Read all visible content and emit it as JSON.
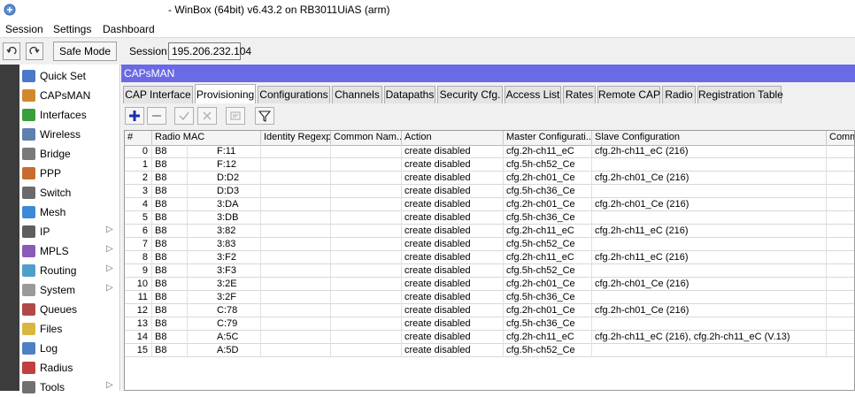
{
  "window": {
    "title": " - WinBox (64bit) v6.43.2 on RB3011UiAS (arm)"
  },
  "menu": [
    "Session",
    "Settings",
    "Dashboard"
  ],
  "toolbar": {
    "undo_icon": "undo-icon",
    "redo_icon": "redo-icon",
    "safe_mode": "Safe Mode",
    "session_label": "Session:",
    "session_value": "195.206.232.104"
  },
  "sidebar": {
    "items": [
      {
        "label": "Quick Set",
        "icon": "quick-set-icon",
        "arrow": false
      },
      {
        "label": "CAPsMAN",
        "icon": "capsman-icon",
        "arrow": false
      },
      {
        "label": "Interfaces",
        "icon": "interfaces-icon",
        "arrow": false
      },
      {
        "label": "Wireless",
        "icon": "wireless-icon",
        "arrow": false
      },
      {
        "label": "Bridge",
        "icon": "bridge-icon",
        "arrow": false
      },
      {
        "label": "PPP",
        "icon": "ppp-icon",
        "arrow": false
      },
      {
        "label": "Switch",
        "icon": "switch-icon",
        "arrow": false
      },
      {
        "label": "Mesh",
        "icon": "mesh-icon",
        "arrow": false
      },
      {
        "label": "IP",
        "icon": "ip-icon",
        "arrow": true
      },
      {
        "label": "MPLS",
        "icon": "mpls-icon",
        "arrow": true
      },
      {
        "label": "Routing",
        "icon": "routing-icon",
        "arrow": true
      },
      {
        "label": "System",
        "icon": "system-icon",
        "arrow": true
      },
      {
        "label": "Queues",
        "icon": "queues-icon",
        "arrow": false
      },
      {
        "label": "Files",
        "icon": "files-icon",
        "arrow": false
      },
      {
        "label": "Log",
        "icon": "log-icon",
        "arrow": false
      },
      {
        "label": "Radius",
        "icon": "radius-icon",
        "arrow": false
      },
      {
        "label": "Tools",
        "icon": "tools-icon",
        "arrow": true
      }
    ]
  },
  "capsman": {
    "title": "CAPsMAN",
    "tabs": [
      {
        "label": "CAP Interface",
        "active": false
      },
      {
        "label": "Provisioning",
        "active": true
      },
      {
        "label": "Configurations",
        "active": false
      },
      {
        "label": "Channels",
        "active": false
      },
      {
        "label": "Datapaths",
        "active": false
      },
      {
        "label": "Security Cfg.",
        "active": false
      },
      {
        "label": "Access List",
        "active": false
      },
      {
        "label": "Rates",
        "active": false
      },
      {
        "label": "Remote CAP",
        "active": false
      },
      {
        "label": "Radio",
        "active": false
      },
      {
        "label": "Registration Table",
        "active": false
      }
    ],
    "actions": [
      "add-icon",
      "remove-icon",
      "enable-icon",
      "disable-icon",
      "comment-icon",
      "filter-icon"
    ],
    "columns": [
      "#",
      "Radio MAC",
      "Identity Regexp",
      "Common Nam...",
      "Action",
      "Master Configurati...",
      "Slave Configuration",
      "Comme"
    ],
    "rows": [
      [
        "0",
        "B8",
        "F:11",
        "",
        "",
        "create disabled",
        "cfg.2h-ch11_eC",
        "cfg.2h-ch11_eC (216)",
        ""
      ],
      [
        "1",
        "B8",
        "F:12",
        "",
        "",
        "create disabled",
        "cfg.5h-ch52_Ce",
        "",
        ""
      ],
      [
        "2",
        "B8",
        "D:D2",
        "",
        "",
        "create disabled",
        "cfg.2h-ch01_Ce",
        "cfg.2h-ch01_Ce (216)",
        ""
      ],
      [
        "3",
        "B8",
        "D:D3",
        "",
        "",
        "create disabled",
        "cfg.5h-ch36_Ce",
        "",
        ""
      ],
      [
        "4",
        "B8",
        "3:DA",
        "",
        "",
        "create disabled",
        "cfg.2h-ch01_Ce",
        "cfg.2h-ch01_Ce (216)",
        ""
      ],
      [
        "5",
        "B8",
        "3:DB",
        "",
        "",
        "create disabled",
        "cfg.5h-ch36_Ce",
        "",
        ""
      ],
      [
        "6",
        "B8",
        "3:82",
        "",
        "",
        "create disabled",
        "cfg.2h-ch11_eC",
        "cfg.2h-ch11_eC (216)",
        ""
      ],
      [
        "7",
        "B8",
        "3:83",
        "",
        "",
        "create disabled",
        "cfg.5h-ch52_Ce",
        "",
        ""
      ],
      [
        "8",
        "B8",
        "3:F2",
        "",
        "",
        "create disabled",
        "cfg.2h-ch11_eC",
        "cfg.2h-ch11_eC (216)",
        ""
      ],
      [
        "9",
        "B8",
        "3:F3",
        "",
        "",
        "create disabled",
        "cfg.5h-ch52_Ce",
        "",
        ""
      ],
      [
        "10",
        "B8",
        "3:2E",
        "",
        "",
        "create disabled",
        "cfg.2h-ch01_Ce",
        "cfg.2h-ch01_Ce (216)",
        ""
      ],
      [
        "11",
        "B8",
        "3:2F",
        "",
        "",
        "create disabled",
        "cfg.5h-ch36_Ce",
        "",
        ""
      ],
      [
        "12",
        "B8",
        "C:78",
        "",
        "",
        "create disabled",
        "cfg.2h-ch01_Ce",
        "cfg.2h-ch01_Ce (216)",
        ""
      ],
      [
        "13",
        "B8",
        "C:79",
        "",
        "",
        "create disabled",
        "cfg.5h-ch36_Ce",
        "",
        ""
      ],
      [
        "14",
        "B8",
        "A:5C",
        "",
        "",
        "create disabled",
        "cfg.2h-ch11_eC",
        "cfg.2h-ch11_eC (216), cfg.2h-ch11_eC (V.13)",
        ""
      ],
      [
        "15",
        "B8",
        "A:5D",
        "",
        "",
        "create disabled",
        "cfg.5h-ch52_Ce",
        "",
        ""
      ]
    ]
  },
  "colors": {
    "accent": "#6a6ae6",
    "strip": "#3c3c3c"
  }
}
